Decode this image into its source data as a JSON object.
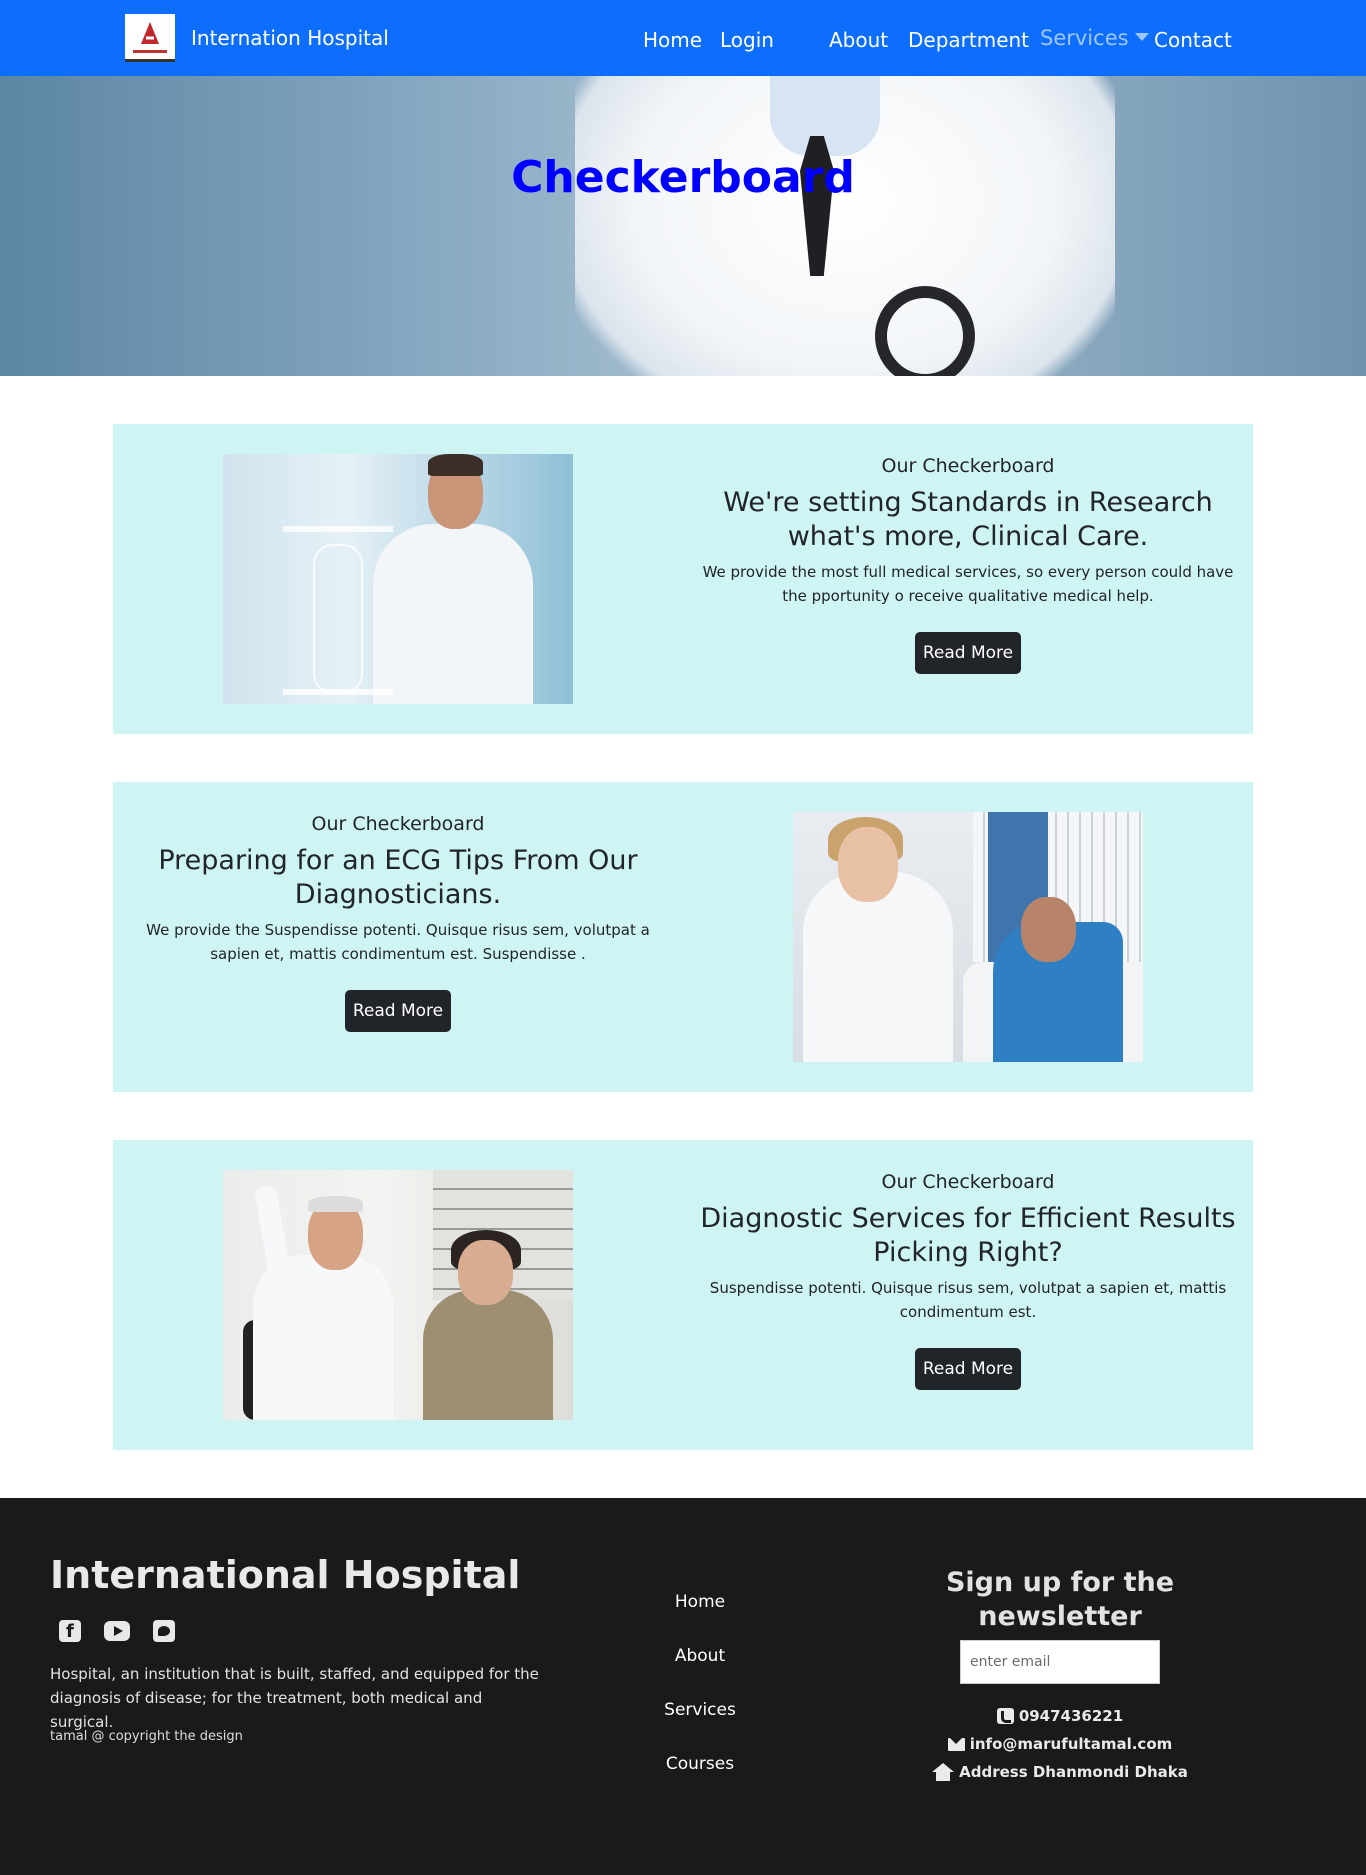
{
  "nav": {
    "brand": "Internation Hospital",
    "links": [
      "Home",
      "Login",
      "About",
      "Department",
      "Services",
      "Contact"
    ]
  },
  "hero": {
    "title": "Checkerboard"
  },
  "cards": [
    {
      "eyebrow": "Our Checkerboard",
      "heading": "We're setting Standards in Research what's more, Clinical Care.",
      "description": "We provide the most full medical services, so every person could have the pportunity o receive qualitative medical help.",
      "button": "Read More"
    },
    {
      "eyebrow": "Our Checkerboard",
      "heading": "Preparing for an ECG Tips From Our Diagnosticians.",
      "description": "We provide the Suspendisse potenti. Quisque risus sem, volutpat a sapien et, mattis condimentum est. Suspendisse .",
      "button": "Read More"
    },
    {
      "eyebrow": "Our Checkerboard",
      "heading": "Diagnostic Services for Efficient Results Picking Right?",
      "description": "Suspendisse potenti. Quisque risus sem, volutpat a sapien et, mattis condimentum est.",
      "button": "Read More"
    }
  ],
  "footer": {
    "title": "International Hospital",
    "social_icons": [
      "facebook-icon",
      "youtube-icon",
      "twitter-icon"
    ],
    "about": "Hospital, an institution that is built, staffed, and equipped for the diagnosis of disease; for the treatment, both medical and surgical.",
    "copyright": "tamal @ copyright the design",
    "links": [
      "Home",
      "About",
      "Services",
      "Courses"
    ],
    "newsletter": {
      "title": "Sign up for the newsletter",
      "placeholder": "enter email",
      "phone": "0947436221",
      "email": "info@marufultamal.com",
      "address": "Address Dhanmondi Dhaka"
    }
  },
  "colors": {
    "navbar": "#0d6efd",
    "hero_title": "#0000ff",
    "card_bg": "#cff4f4",
    "button_bg": "#212529",
    "footer_bg": "#1a1a1b"
  }
}
